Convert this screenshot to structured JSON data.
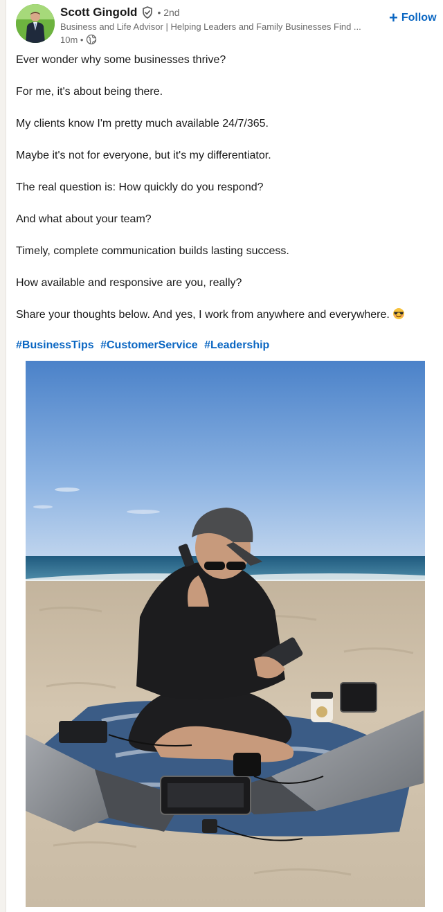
{
  "post": {
    "author": {
      "name": "Scott Gingold",
      "verified_icon": "verified-shield-icon",
      "degree": "• 2nd",
      "headline": "Business and Life Advisor | Helping Leaders and Family Businesses Find ...",
      "time": "10m •",
      "visibility_icon": "globe-icon"
    },
    "follow_label": "Follow",
    "body": [
      "Ever wonder why some businesses thrive?",
      "For me, it's about being there.",
      "My clients know I'm pretty much available 24/7/365.",
      "Maybe it's not for everyone, but it's my differentiator.",
      "The real question is: How quickly do you respond?",
      "And what about your team?",
      "Timely, complete communication builds lasting success.",
      "How available and responsive are you, really?",
      "Share your thoughts below. And yes, I work from anywhere and everywhere."
    ],
    "emoji": "smiling-face-with-sunglasses-icon",
    "hashtags": [
      "#BusinessTips",
      "#CustomerService",
      "#Leadership"
    ],
    "image": "beach-work-photo"
  },
  "colors": {
    "link_blue": "#0a66c2",
    "text_primary": "rgba(0,0,0,0.9)",
    "text_secondary": "rgba(0,0,0,0.6)"
  }
}
